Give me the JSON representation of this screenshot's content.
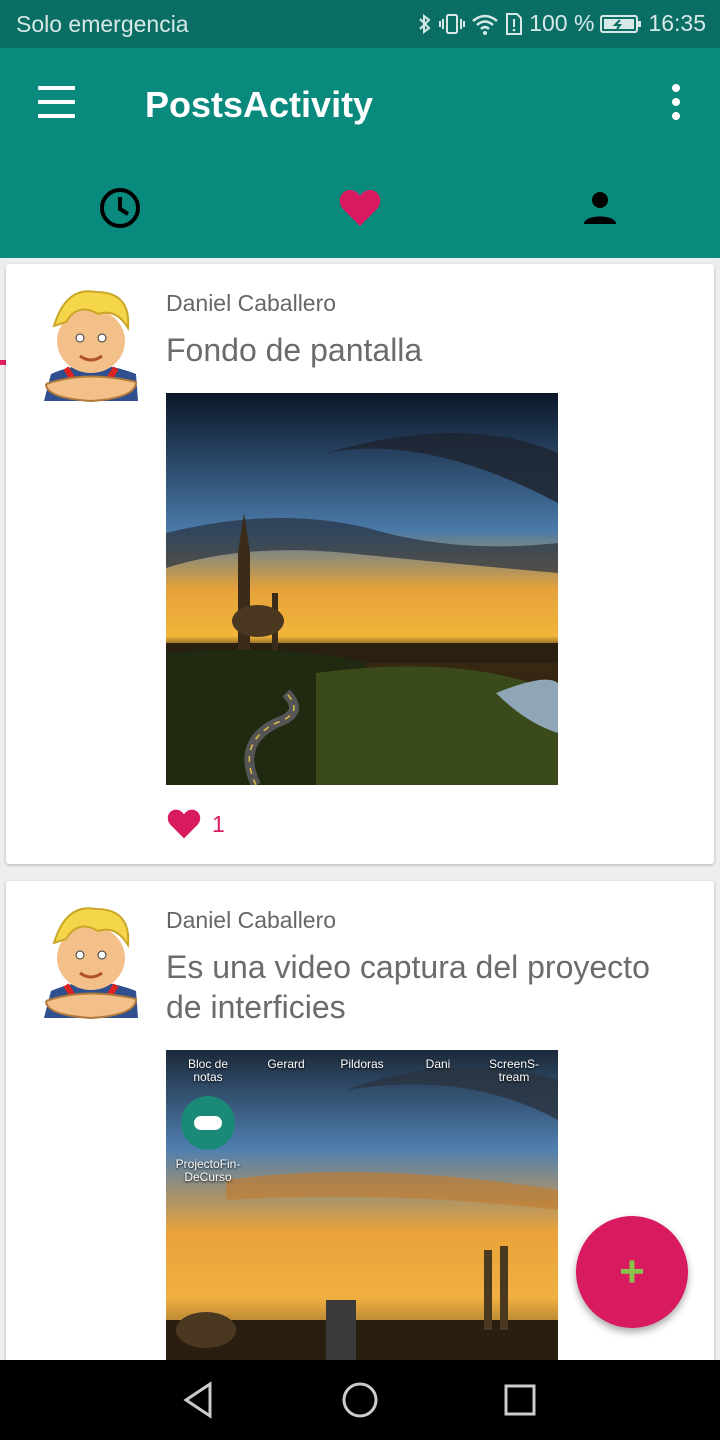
{
  "status": {
    "left_text": "Solo emergencia",
    "battery": "100 %",
    "time": "16:35"
  },
  "appbar": {
    "title": "PostsActivity"
  },
  "tabs": [
    {
      "name": "recent",
      "icon": "clock-icon"
    },
    {
      "name": "favorites",
      "icon": "heart-icon"
    },
    {
      "name": "profile",
      "icon": "person-icon"
    }
  ],
  "colors": {
    "primary": "#0a8a7d",
    "primary_dark": "#0b6e64",
    "accent": "#d81b60",
    "fab_icon": "#8bc34a"
  },
  "posts": [
    {
      "author": "Daniel Caballero",
      "title": "Fondo de pantalla",
      "likes": "1"
    },
    {
      "author": "Daniel Caballero",
      "title": "Es una video captura del proyecto de interficies",
      "screenshot_labels": {
        "a1": "Bloc de",
        "a2": "notas",
        "b": "Gerard",
        "c": "Pildoras",
        "d": "Dani",
        "e1": "ScreenS-",
        "e2": "tream",
        "f1": "ProjectoFin-",
        "f2": "DeCurso"
      }
    }
  ],
  "fab": {
    "label": "+"
  }
}
